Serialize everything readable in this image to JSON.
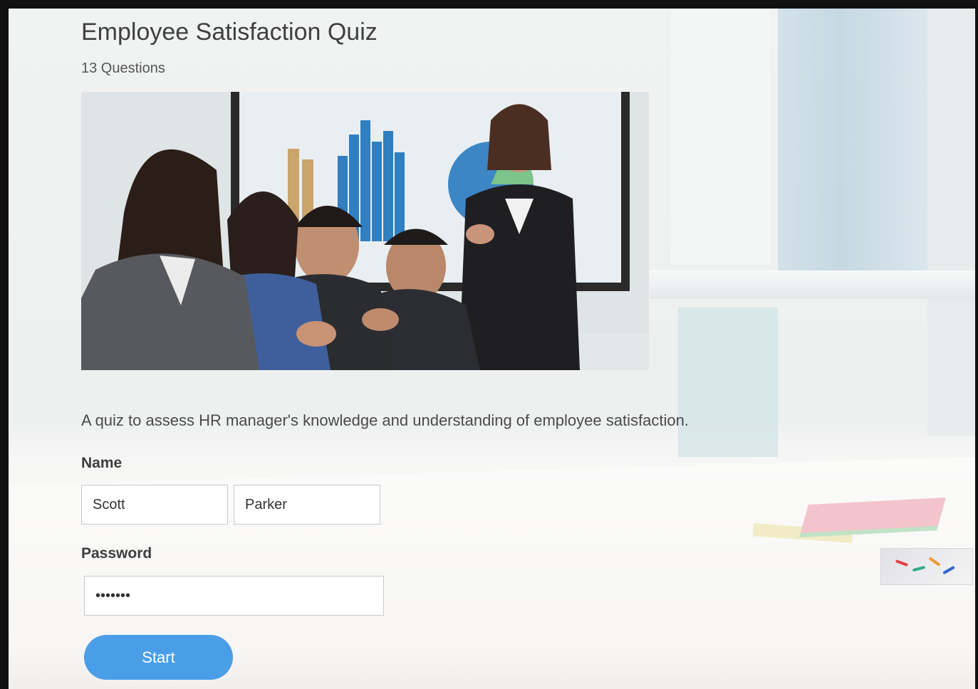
{
  "quiz": {
    "title": "Employee Satisfaction Quiz",
    "question_count": "13 Questions",
    "description": "A quiz to assess HR manager's knowledge and understanding of employee satisfaction."
  },
  "form": {
    "name_label": "Name",
    "first_name_value": "Scott",
    "last_name_value": "Parker",
    "password_label": "Password",
    "password_value": "1234567",
    "start_label": "Start"
  },
  "colors": {
    "accent": "#4a9ee8",
    "text": "#3f3f3f"
  }
}
